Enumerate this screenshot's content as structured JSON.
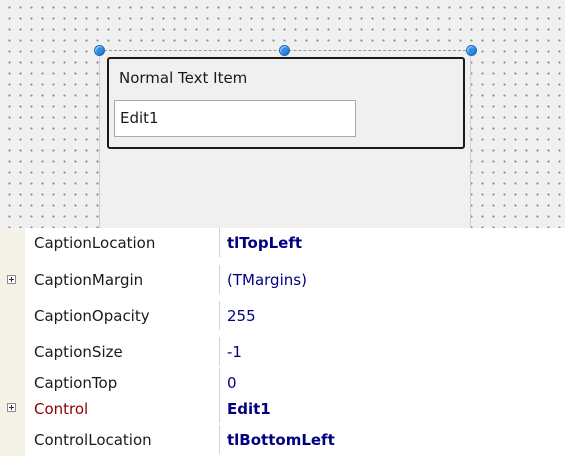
{
  "designer": {
    "caption": "Normal Text Item",
    "edit_value": "Edit1"
  },
  "inspector": {
    "properties": [
      {
        "name": "CaptionLocation",
        "value": "tlTopLeft",
        "expandable": false
      },
      {
        "name": "CaptionMargin",
        "value": "(TMargins)",
        "expandable": true
      },
      {
        "name": "CaptionOpacity",
        "value": "255",
        "expandable": false
      },
      {
        "name": "CaptionSize",
        "value": "-1",
        "expandable": false
      },
      {
        "name": "CaptionTop",
        "value": "0",
        "expandable": false
      },
      {
        "name": "Control",
        "value": "Edit1",
        "expandable": true
      },
      {
        "name": "ControlLocation",
        "value": "tlBottomLeft",
        "expandable": false
      }
    ]
  },
  "colors": {
    "property_value": "#000080",
    "reference_property_name": "#8b0000",
    "selection_grip": "#2f8de8",
    "designer_background": "#f0f0f0"
  }
}
